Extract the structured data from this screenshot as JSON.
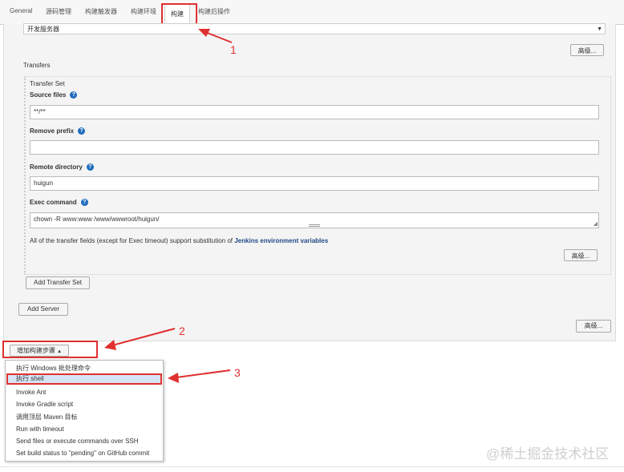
{
  "tabs": [
    "General",
    "源码管理",
    "构建触发器",
    "构建环境",
    "构建",
    "构建后操作"
  ],
  "server_select": {
    "value": "开发服务器"
  },
  "advanced_label": "高级...",
  "transfers_label": "Transfers",
  "transfer_set_label": "Transfer Set",
  "fields": {
    "source_files": {
      "label": "Source files",
      "value": "**/**"
    },
    "remove_prefix": {
      "label": "Remove prefix",
      "value": ""
    },
    "remote_directory": {
      "label": "Remote directory",
      "value": "huigun"
    },
    "exec_command": {
      "label": "Exec command",
      "value": "chown -R www:www /www/wwwroot/huigun/"
    }
  },
  "substitution_note_prefix": "All of the transfer fields (except for Exec timeout) support substitution of ",
  "substitution_note_link": "Jenkins environment variables",
  "add_transfer_set_label": "Add Transfer Set",
  "add_server_label": "Add Server",
  "add_build_step_label": "增加构建步骤",
  "menu_items": [
    "执行 Windows 批处理命令",
    "执行 shell",
    "Invoke Ant",
    "Invoke Gradle script",
    "调用顶层 Maven 目标",
    "Run with timeout",
    "Send files or execute commands over SSH",
    "Set build status to \"pending\" on GitHub commit"
  ],
  "callouts": [
    "1",
    "2",
    "3"
  ],
  "watermark": "@稀土掘金技术社区",
  "colors": {
    "accent": "#e03030",
    "link": "#204a87",
    "help": "#1e6bbd"
  }
}
